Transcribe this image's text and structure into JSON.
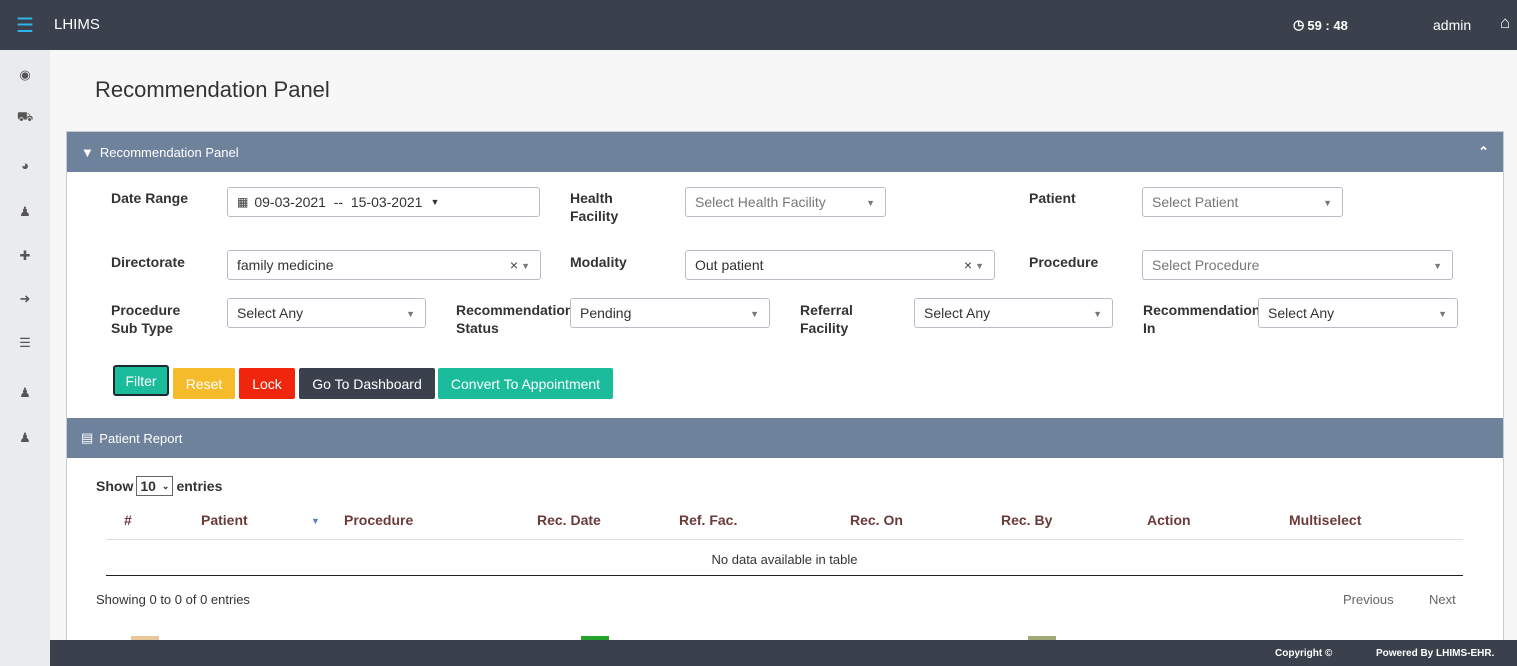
{
  "app": {
    "brand": "LHIMS",
    "timer": "59 : 48",
    "user": "admin"
  },
  "page": {
    "title": "Recommendation Panel"
  },
  "filter_panel": {
    "heading": "Recommendation Panel",
    "date_range": {
      "label": "Date Range",
      "value": "09-03-2021  --  15-03-2021"
    },
    "health_facility": {
      "label_line1": "Health",
      "label_line2": "Facility",
      "placeholder": "Select Health Facility"
    },
    "patient": {
      "label": "Patient",
      "placeholder": "Select Patient"
    },
    "directorate": {
      "label": "Directorate",
      "value": "family medicine"
    },
    "modality": {
      "label": "Modality",
      "value": "Out patient"
    },
    "procedure": {
      "label": "Procedure",
      "placeholder": "Select Procedure"
    },
    "procedure_sub_type": {
      "label_line1": "Procedure",
      "label_line2": "Sub Type",
      "value": "Select Any"
    },
    "recommendation_status": {
      "label_line1": "Recommendation",
      "label_line2": "Status",
      "value": "Pending"
    },
    "referral_facility": {
      "label_line1": "Referral",
      "label_line2": "Facility",
      "value": "Select Any"
    },
    "recommendation_in": {
      "label_line1": "Recommendation",
      "label_line2": "In",
      "value": "Select Any"
    },
    "buttons": {
      "filter": "Filter",
      "reset": "Reset",
      "lock": "Lock",
      "dashboard": "Go To Dashboard",
      "convert": "Convert To Appointment"
    }
  },
  "report": {
    "heading": "Patient Report",
    "show_label": "Show",
    "entries_value": "10",
    "entries_label": "entries",
    "columns": [
      "#",
      "Patient",
      "Procedure",
      "Rec. Date",
      "Ref. Fac.",
      "Rec. On",
      "Rec. By",
      "Action",
      "Multiselect"
    ],
    "empty_text": "No data available in table",
    "info": "Showing 0 to 0 of 0 entries",
    "previous": "Previous",
    "next": "Next"
  },
  "footer": {
    "copyright": "Copyright ©",
    "powered": "Powered By LHIMS-EHR."
  },
  "colors": {
    "topbar": "#3a414d",
    "panel_header": "#6f829c",
    "filter_btn": "#1abc9c",
    "reset_btn": "#f6bb2a",
    "lock_btn": "#f0250d",
    "dashboard_btn": "#3a414d",
    "convert_btn": "#1abc9c",
    "legend_1": "#e8c79a",
    "legend_2": "#23a32a",
    "legend_3": "#a3a878"
  }
}
